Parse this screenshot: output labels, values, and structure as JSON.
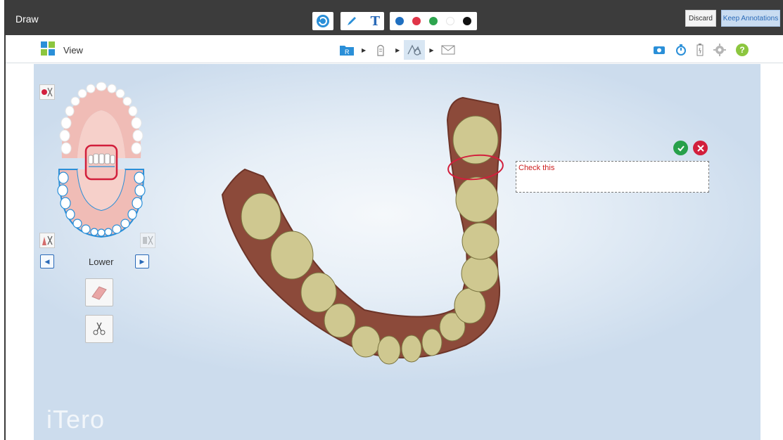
{
  "header": {
    "title": "Draw",
    "undo_icon": "undo-icon",
    "pen_icon": "pen-icon",
    "text_icon": "text-tool-icon",
    "text_tool_glyph": "T",
    "colors": [
      "#1f6fc0",
      "#e03548",
      "#2da44e",
      "#ffffff",
      "#111111"
    ],
    "discard_label": "Discard",
    "keep_label": "Keep Annotations"
  },
  "viewbar": {
    "view_label": "View",
    "workflow_steps": [
      {
        "name": "rx-folder-icon",
        "glyph": "R",
        "active": false
      },
      {
        "name": "scan-icon",
        "active": false
      },
      {
        "name": "view-tools-icon",
        "active": true
      },
      {
        "name": "send-icon",
        "active": false
      }
    ],
    "right_tools": [
      "snapshot-icon",
      "timer-icon",
      "battery-icon",
      "settings-icon",
      "help-icon"
    ],
    "help_glyph": "?"
  },
  "canvas": {
    "jaw_label": "Lower",
    "annotation_text": "Check this",
    "brand": "iTero",
    "brand_color": "#ffffff",
    "annotation_color": "#cc1e1e"
  }
}
